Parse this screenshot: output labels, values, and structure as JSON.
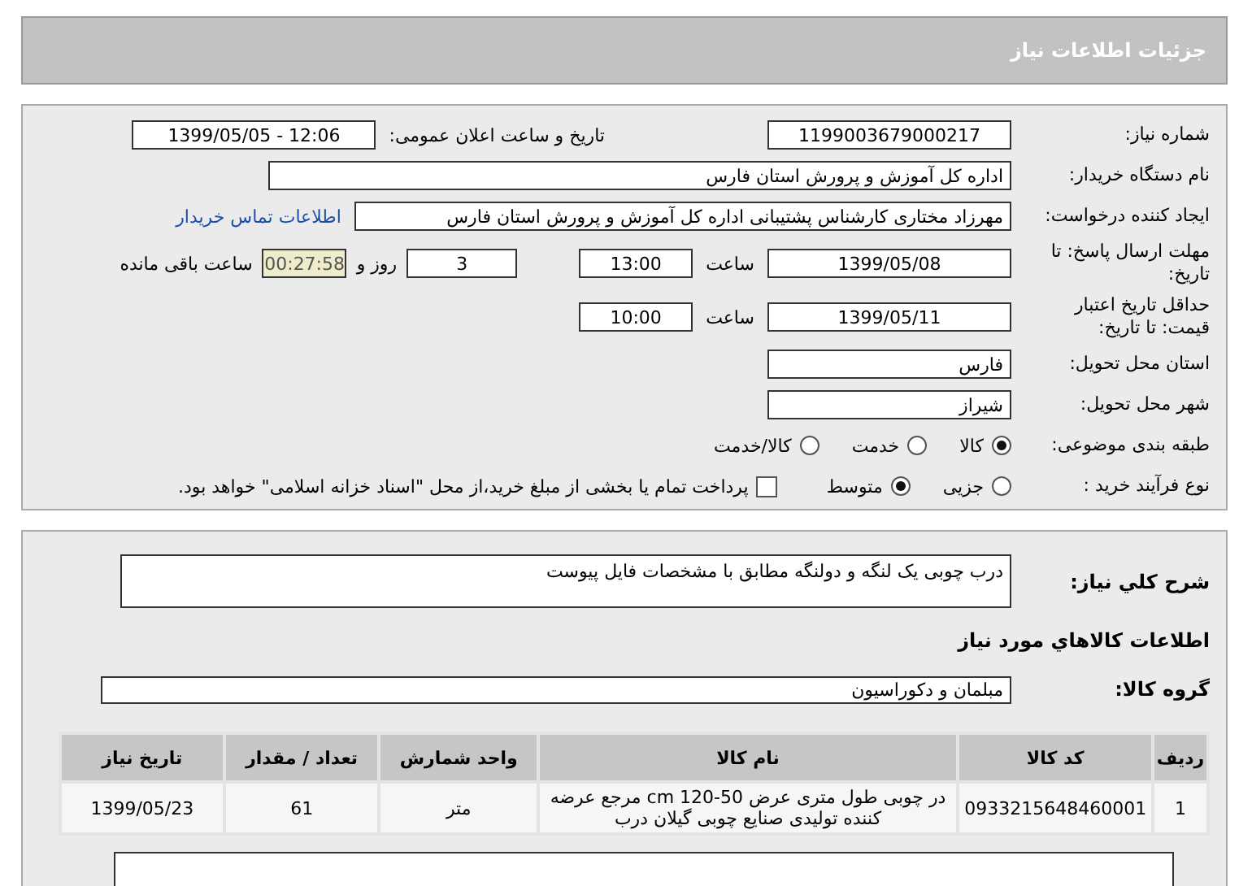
{
  "header": {
    "title": "جزئیات اطلاعات نیاز"
  },
  "need_number": {
    "label": "شماره نیاز:",
    "value": "1199003679000217"
  },
  "announce": {
    "label": "تاریخ و ساعت اعلان عمومی:",
    "value": "1399/05/05 - 12:06"
  },
  "buyer": {
    "label": "نام دستگاه خریدار:",
    "value": "اداره کل آموزش و پرورش استان فارس"
  },
  "requester": {
    "label": "ایجاد کننده درخواست:",
    "value": "مهرزاد  مختاری  کارشناس پشتیبانی اداره کل آموزش و پرورش استان فارس",
    "contact_link": "اطلاعات تماس خریدار"
  },
  "reply_deadline": {
    "label": "مهلت ارسال پاسخ: تا تاریخ:",
    "date": "1399/05/08",
    "time_label": "ساعت",
    "time": "13:00",
    "days": "3",
    "days_label": "روز و",
    "remaining": "00:27:58",
    "remaining_label": "ساعت باقی مانده"
  },
  "price_validity": {
    "label": "حداقل تاریخ اعتبار قیمت: تا تاریخ:",
    "date": "1399/05/11",
    "time_label": "ساعت",
    "time": "10:00"
  },
  "province": {
    "label": "استان محل تحویل:",
    "value": "فارس"
  },
  "city": {
    "label": "شهر محل تحویل:",
    "value": "شیراز"
  },
  "category": {
    "label": "طبقه بندی موضوعی:",
    "options": [
      {
        "label": "کالا",
        "selected": true
      },
      {
        "label": "خدمت",
        "selected": false
      },
      {
        "label": "کالا/خدمت",
        "selected": false
      }
    ]
  },
  "process": {
    "label": "نوع فرآیند خرید :",
    "options": [
      {
        "label": "جزیی",
        "selected": false
      },
      {
        "label": "متوسط",
        "selected": true
      }
    ],
    "payment_checkbox": {
      "label": "پرداخت تمام یا بخشی از مبلغ خرید،از محل \"اسناد خزانه اسلامی\" خواهد بود.",
      "checked": false
    }
  },
  "description": {
    "label": "شرح کلي نياز:",
    "value": "درب چوبی یک لنگه و دولنگه مطابق با مشخصات فایل پیوست"
  },
  "goods_heading": "اطلاعات کالاهاي مورد نياز",
  "goods_group": {
    "label": "گروه کالا:",
    "value": "مبلمان و دکوراسیون"
  },
  "table": {
    "columns": [
      "ردیف",
      "کد کالا",
      "نام کالا",
      "واحد شمارش",
      "تعداد / مقدار",
      "تاریخ نیاز"
    ],
    "rows": [
      [
        "1",
        "0933215648460001",
        "در چوبی طول متری عرض cm 120-50 مرجع عرضه کننده تولیدی صنایع چوبی گیلان درب",
        "متر",
        "61",
        "1399/05/23"
      ]
    ]
  }
}
